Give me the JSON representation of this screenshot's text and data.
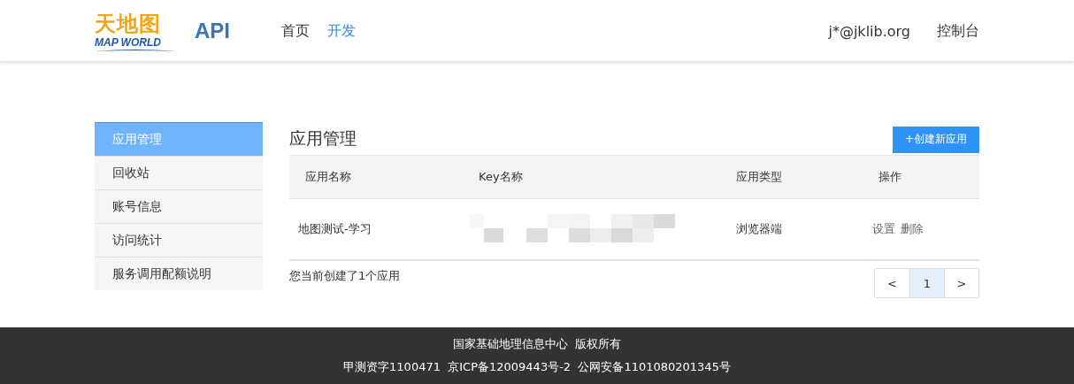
{
  "header": {
    "logo": {
      "title": "天地图",
      "subtitle": "MAP WORLD"
    },
    "product": "API",
    "nav": [
      {
        "label": "首页",
        "selected": false
      },
      {
        "label": "开发",
        "selected": true
      }
    ],
    "user": "j*@jklib.org",
    "console": "控制台"
  },
  "sidebar": {
    "items": [
      {
        "label": "应用管理",
        "selected": true
      },
      {
        "label": "回收站",
        "selected": false
      },
      {
        "label": "账号信息",
        "selected": false
      },
      {
        "label": "访问统计",
        "selected": false
      },
      {
        "label": "服务调用配额说明",
        "selected": false
      }
    ]
  },
  "main": {
    "title": "应用管理",
    "create_button": "+创建新应用",
    "table": {
      "columns": [
        "应用名称",
        "Key名称",
        "应用类型",
        "操作"
      ],
      "rows": [
        {
          "name": "地图测试-学习",
          "key": {
            "kind": "redacted"
          },
          "type": "浏览器端",
          "actions": [
            "设置",
            "删除"
          ]
        }
      ]
    },
    "summary": "您当前创建了1个应用",
    "pagination": {
      "prev": "<",
      "pages": [
        {
          "label": "1",
          "selected": true
        }
      ],
      "next": ">"
    }
  },
  "footer": {
    "lines": [
      "国家基础地理信息中心  版权所有",
      "甲测资字1100471  京ICP备12009443号-2  公网安备1101080201345号"
    ]
  }
}
